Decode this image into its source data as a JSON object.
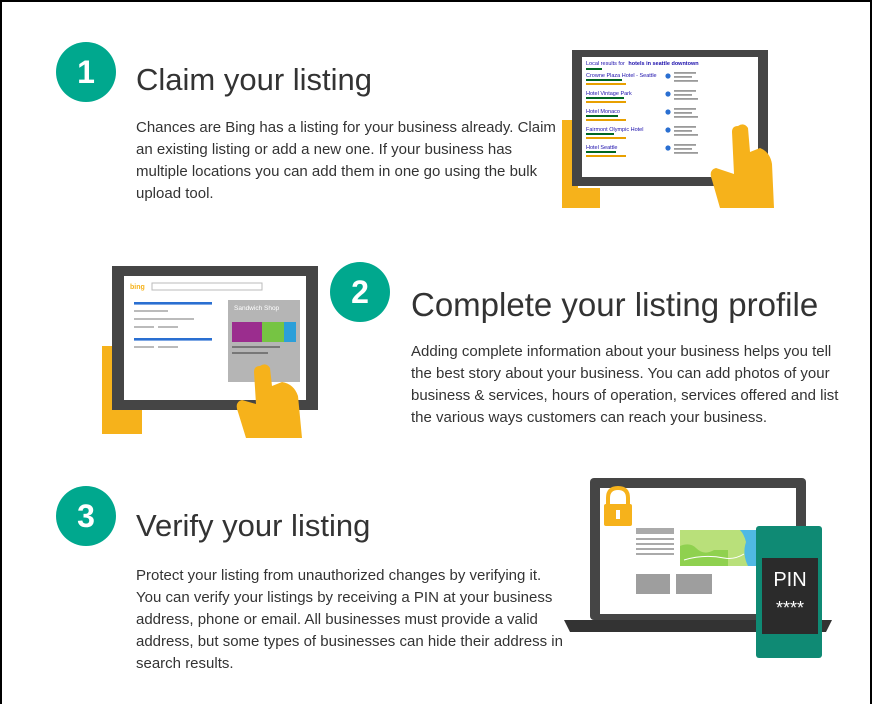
{
  "steps": [
    {
      "number": "1",
      "title": "Claim your listing",
      "description": "Chances are Bing has a listing for your business already. Claim an existing listing or add a new one. If your business has multiple locations you can add them in one go using the bulk upload tool."
    },
    {
      "number": "2",
      "title": "Complete your listing profile",
      "description": "Adding complete information about your business helps you tell the best story about your business. You can add photos of your business & services, hours of operation, services offered and list the various ways customers can reach your business."
    },
    {
      "number": "3",
      "title": "Verify your listing",
      "description": "Protect your listing from unauthorized changes by verifying it. You can verify your listings by receiving a PIN at your business address, phone or email. All businesses must provide a valid address, but some types of businesses can hide their address in search results."
    }
  ],
  "illustration1": {
    "header_prefix": "Local results for",
    "header_query": "hotels in seattle downtown",
    "results": [
      "Crowne Plaza Hotel - Seattle",
      "Hotel Vintage Park",
      "Hotel Monaco",
      "Fairmont Olympic Hotel",
      "Hotel Seattle"
    ]
  },
  "illustration2": {
    "logo": "bing",
    "card_title": "Sandwich Shop"
  },
  "illustration3": {
    "pin_label": "PIN",
    "pin_mask": "****"
  },
  "colors": {
    "badge": "#00a88e",
    "hand": "#f6b21b",
    "device": "#454545",
    "phone": "#0f8a74",
    "link": "#1a0dab"
  }
}
